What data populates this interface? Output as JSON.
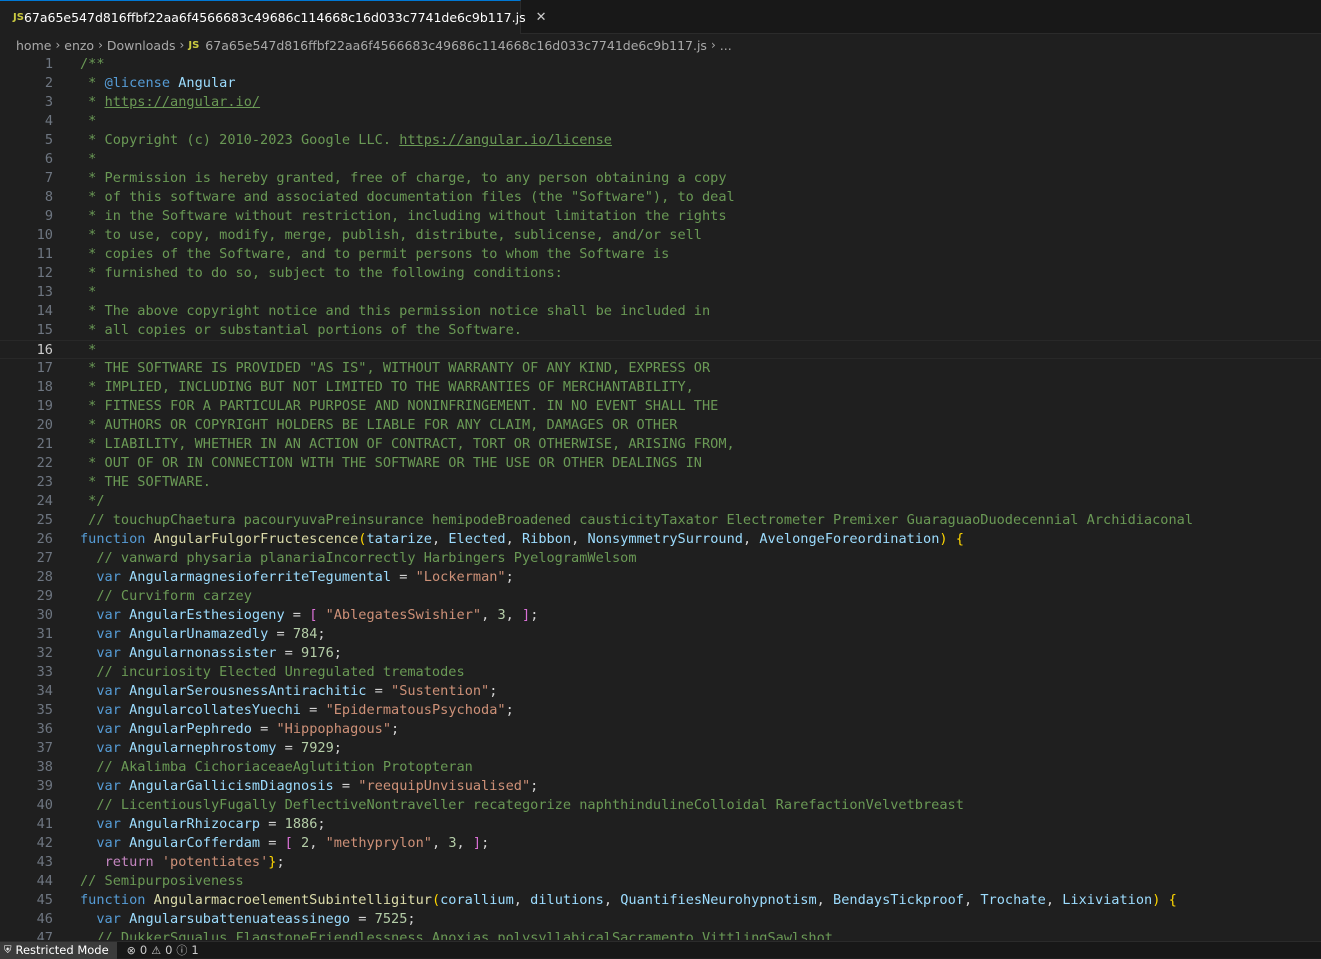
{
  "tab": {
    "icon": "js-file-icon",
    "icon_text": "JS",
    "title": "67a65e547d816ffbf22aa6f4566683c49686c114668c16d033c7741de6c9b117.js",
    "close": "✕"
  },
  "breadcrumb": {
    "items": [
      "home",
      "enzo",
      "Downloads"
    ],
    "file_icon_text": "JS",
    "file": "67a65e547d816ffbf22aa6f4566683c49686c114668c16d033c7741de6c9b117.js",
    "tail": "..."
  },
  "editor": {
    "active_line": 16,
    "lines": [
      [
        [
          "c-comment",
          "/**"
        ]
      ],
      [
        [
          "c-comment",
          " * "
        ],
        [
          "c-tag",
          "@license"
        ],
        [
          "c-comment",
          " "
        ],
        [
          "c-var",
          "Angular"
        ]
      ],
      [
        [
          "c-comment",
          " * "
        ],
        [
          "c-link",
          "https://angular.io/"
        ]
      ],
      [
        [
          "c-comment",
          " *"
        ]
      ],
      [
        [
          "c-comment",
          " * Copyright (c) 2010-2023 Google LLC. "
        ],
        [
          "c-link",
          "https://angular.io/license"
        ]
      ],
      [
        [
          "c-comment",
          " *"
        ]
      ],
      [
        [
          "c-comment",
          " * Permission is hereby granted, free of charge, to any person obtaining a copy"
        ]
      ],
      [
        [
          "c-comment",
          " * of this software and associated documentation files (the \"Software\"), to deal"
        ]
      ],
      [
        [
          "c-comment",
          " * in the Software without restriction, including without limitation the rights"
        ]
      ],
      [
        [
          "c-comment",
          " * to use, copy, modify, merge, publish, distribute, sublicense, and/or sell"
        ]
      ],
      [
        [
          "c-comment",
          " * copies of the Software, and to permit persons to whom the Software is"
        ]
      ],
      [
        [
          "c-comment",
          " * furnished to do so, subject to the following conditions:"
        ]
      ],
      [
        [
          "c-comment",
          " *"
        ]
      ],
      [
        [
          "c-comment",
          " * The above copyright notice and this permission notice shall be included in"
        ]
      ],
      [
        [
          "c-comment",
          " * all copies or substantial portions of the Software."
        ]
      ],
      [
        [
          "c-comment",
          " *"
        ]
      ],
      [
        [
          "c-comment",
          " * THE SOFTWARE IS PROVIDED \"AS IS\", WITHOUT WARRANTY OF ANY KIND, EXPRESS OR"
        ]
      ],
      [
        [
          "c-comment",
          " * IMPLIED, INCLUDING BUT NOT LIMITED TO THE WARRANTIES OF MERCHANTABILITY,"
        ]
      ],
      [
        [
          "c-comment",
          " * FITNESS FOR A PARTICULAR PURPOSE AND NONINFRINGEMENT. IN NO EVENT SHALL THE"
        ]
      ],
      [
        [
          "c-comment",
          " * AUTHORS OR COPYRIGHT HOLDERS BE LIABLE FOR ANY CLAIM, DAMAGES OR OTHER"
        ]
      ],
      [
        [
          "c-comment",
          " * LIABILITY, WHETHER IN AN ACTION OF CONTRACT, TORT OR OTHERWISE, ARISING FROM,"
        ]
      ],
      [
        [
          "c-comment",
          " * OUT OF OR IN CONNECTION WITH THE SOFTWARE OR THE USE OR OTHER DEALINGS IN"
        ]
      ],
      [
        [
          "c-comment",
          " * THE SOFTWARE."
        ]
      ],
      [
        [
          "c-comment",
          " */"
        ]
      ],
      [
        [
          "c-comment",
          " // touchupChaetura pacouryuvaPreinsurance hemipodeBroadened causticityTaxator Electrometer Premixer GuaraguaoDuodecennial Archidiaconal"
        ]
      ],
      [
        [
          "c-kw",
          "function"
        ],
        [
          "c-punc",
          " "
        ],
        [
          "c-fn",
          "AngularFulgorFructescence"
        ],
        [
          "c-brace",
          "("
        ],
        [
          "c-param",
          "tatarize"
        ],
        [
          "c-punc",
          ", "
        ],
        [
          "c-param",
          "Elected"
        ],
        [
          "c-punc",
          ", "
        ],
        [
          "c-param",
          "Ribbon"
        ],
        [
          "c-punc",
          ", "
        ],
        [
          "c-param",
          "NonsymmetrySurround"
        ],
        [
          "c-punc",
          ", "
        ],
        [
          "c-param",
          "AvelongeForeordination"
        ],
        [
          "c-brace",
          ")"
        ],
        [
          "c-punc",
          " "
        ],
        [
          "c-brace",
          "{"
        ]
      ],
      [
        [
          "c-punc",
          "  "
        ],
        [
          "c-comment",
          "// vanward physaria planariaIncorrectly Harbingers PyelogramWelsom"
        ]
      ],
      [
        [
          "c-punc",
          "  "
        ],
        [
          "c-kw",
          "var"
        ],
        [
          "c-punc",
          " "
        ],
        [
          "c-var",
          "AngularmagnesioferriteTegumental"
        ],
        [
          "c-punc",
          " = "
        ],
        [
          "c-str",
          "\"Lockerman\""
        ],
        [
          "c-punc",
          ";"
        ]
      ],
      [
        [
          "c-punc",
          "  "
        ],
        [
          "c-comment",
          "// Curviform carzey"
        ]
      ],
      [
        [
          "c-punc",
          "  "
        ],
        [
          "c-kw",
          "var"
        ],
        [
          "c-punc",
          " "
        ],
        [
          "c-var",
          "AngularEsthesiogeny"
        ],
        [
          "c-punc",
          " = "
        ],
        [
          "c-bracket",
          "["
        ],
        [
          "c-punc",
          " "
        ],
        [
          "c-str",
          "\"AblegatesSwishier\""
        ],
        [
          "c-punc",
          ", "
        ],
        [
          "c-num",
          "3"
        ],
        [
          "c-punc",
          ", "
        ],
        [
          "c-bracket",
          "]"
        ],
        [
          "c-punc",
          ";"
        ]
      ],
      [
        [
          "c-punc",
          "  "
        ],
        [
          "c-kw",
          "var"
        ],
        [
          "c-punc",
          " "
        ],
        [
          "c-var",
          "AngularUnamazedly"
        ],
        [
          "c-punc",
          " = "
        ],
        [
          "c-num",
          "784"
        ],
        [
          "c-punc",
          ";"
        ]
      ],
      [
        [
          "c-punc",
          "  "
        ],
        [
          "c-kw",
          "var"
        ],
        [
          "c-punc",
          " "
        ],
        [
          "c-var",
          "Angularnonassister"
        ],
        [
          "c-punc",
          " = "
        ],
        [
          "c-num",
          "9176"
        ],
        [
          "c-punc",
          ";"
        ]
      ],
      [
        [
          "c-punc",
          "  "
        ],
        [
          "c-comment",
          "// incuriosity Elected Unregulated trematodes"
        ]
      ],
      [
        [
          "c-punc",
          "  "
        ],
        [
          "c-kw",
          "var"
        ],
        [
          "c-punc",
          " "
        ],
        [
          "c-var",
          "AngularSerousnessAntirachitic"
        ],
        [
          "c-punc",
          " = "
        ],
        [
          "c-str",
          "\"Sustention\""
        ],
        [
          "c-punc",
          ";"
        ]
      ],
      [
        [
          "c-punc",
          "  "
        ],
        [
          "c-kw",
          "var"
        ],
        [
          "c-punc",
          " "
        ],
        [
          "c-var",
          "AngularcollatesYuechi"
        ],
        [
          "c-punc",
          " = "
        ],
        [
          "c-str",
          "\"EpidermatousPsychoda\""
        ],
        [
          "c-punc",
          ";"
        ]
      ],
      [
        [
          "c-punc",
          "  "
        ],
        [
          "c-kw",
          "var"
        ],
        [
          "c-punc",
          " "
        ],
        [
          "c-var",
          "AngularPephredo"
        ],
        [
          "c-punc",
          " = "
        ],
        [
          "c-str",
          "\"Hippophagous\""
        ],
        [
          "c-punc",
          ";"
        ]
      ],
      [
        [
          "c-punc",
          "  "
        ],
        [
          "c-kw",
          "var"
        ],
        [
          "c-punc",
          " "
        ],
        [
          "c-var",
          "Angularnephrostomy"
        ],
        [
          "c-punc",
          " = "
        ],
        [
          "c-num",
          "7929"
        ],
        [
          "c-punc",
          ";"
        ]
      ],
      [
        [
          "c-punc",
          "  "
        ],
        [
          "c-comment",
          "// Akalimba CichoriaceaeAglutition Protopteran"
        ]
      ],
      [
        [
          "c-punc",
          "  "
        ],
        [
          "c-kw",
          "var"
        ],
        [
          "c-punc",
          " "
        ],
        [
          "c-var",
          "AngularGallicismDiagnosis"
        ],
        [
          "c-punc",
          " = "
        ],
        [
          "c-str",
          "\"reequipUnvisualised\""
        ],
        [
          "c-punc",
          ";"
        ]
      ],
      [
        [
          "c-punc",
          "  "
        ],
        [
          "c-comment",
          "// LicentiouslyFugally DeflectiveNontraveller recategorize naphthindulineColloidal RarefactionVelvetbreast"
        ]
      ],
      [
        [
          "c-punc",
          "  "
        ],
        [
          "c-kw",
          "var"
        ],
        [
          "c-punc",
          " "
        ],
        [
          "c-var",
          "AngularRhizocarp"
        ],
        [
          "c-punc",
          " = "
        ],
        [
          "c-num",
          "1886"
        ],
        [
          "c-punc",
          ";"
        ]
      ],
      [
        [
          "c-punc",
          "  "
        ],
        [
          "c-kw",
          "var"
        ],
        [
          "c-punc",
          " "
        ],
        [
          "c-var",
          "AngularCofferdam"
        ],
        [
          "c-punc",
          " = "
        ],
        [
          "c-bracket",
          "["
        ],
        [
          "c-punc",
          " "
        ],
        [
          "c-num",
          "2"
        ],
        [
          "c-punc",
          ", "
        ],
        [
          "c-str",
          "\"methyprylon\""
        ],
        [
          "c-punc",
          ", "
        ],
        [
          "c-num",
          "3"
        ],
        [
          "c-punc",
          ", "
        ],
        [
          "c-bracket",
          "]"
        ],
        [
          "c-punc",
          ";"
        ]
      ],
      [
        [
          "c-punc",
          "   "
        ],
        [
          "c-ret",
          "return"
        ],
        [
          "c-punc",
          " "
        ],
        [
          "c-str",
          "'potentiates'"
        ],
        [
          "c-brace",
          "}"
        ],
        [
          "c-punc",
          ";"
        ]
      ],
      [
        [
          "c-comment",
          "// Semipurposiveness"
        ]
      ],
      [
        [
          "c-kw",
          "function"
        ],
        [
          "c-punc",
          " "
        ],
        [
          "c-fn",
          "AngularmacroelementSubintelligitur"
        ],
        [
          "c-brace",
          "("
        ],
        [
          "c-param",
          "corallium"
        ],
        [
          "c-punc",
          ", "
        ],
        [
          "c-param",
          "dilutions"
        ],
        [
          "c-punc",
          ", "
        ],
        [
          "c-param",
          "QuantifiesNeurohypnotism"
        ],
        [
          "c-punc",
          ", "
        ],
        [
          "c-param",
          "BendaysTickproof"
        ],
        [
          "c-punc",
          ", "
        ],
        [
          "c-param",
          "Trochate"
        ],
        [
          "c-punc",
          ", "
        ],
        [
          "c-param",
          "Lixiviation"
        ],
        [
          "c-brace",
          ")"
        ],
        [
          "c-punc",
          " "
        ],
        [
          "c-brace",
          "{"
        ]
      ],
      [
        [
          "c-punc",
          "  "
        ],
        [
          "c-kw",
          "var"
        ],
        [
          "c-punc",
          " "
        ],
        [
          "c-var",
          "Angularsubattenuateassinego"
        ],
        [
          "c-punc",
          " = "
        ],
        [
          "c-num",
          "7525"
        ],
        [
          "c-punc",
          ";"
        ]
      ],
      [
        [
          "c-punc",
          "  "
        ],
        [
          "c-comment",
          "// DukkerSqualus FlagstoneFriendlessness Anoxias polysyllabicalSacramento VittlingSawlshot"
        ]
      ]
    ]
  },
  "status": {
    "restricted_icon": "shield-icon",
    "restricted_label": "Restricted Mode",
    "errors": "0",
    "warnings": "0",
    "info": "1"
  }
}
